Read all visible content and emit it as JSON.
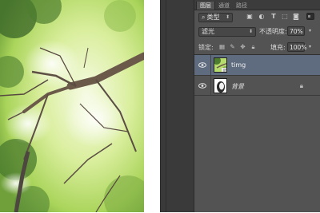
{
  "canvas": {
    "description_icon": "forest-canopy-photo"
  },
  "layers_panel": {
    "tabs": [
      {
        "label": "图层",
        "active": true
      },
      {
        "label": "通道",
        "active": false
      },
      {
        "label": "路径",
        "active": false
      }
    ],
    "filter": {
      "label": "类型",
      "icons": [
        "image-filter-icon",
        "adjustment-filter-icon",
        "type-filter-icon",
        "shape-filter-icon",
        "smart-object-filter-icon"
      ]
    },
    "blend_mode": "滤光",
    "opacity": {
      "label": "不透明度:",
      "value": "70%"
    },
    "lock": {
      "label": "锁定:",
      "icons": [
        "lock-transparent-icon",
        "lock-image-icon",
        "lock-position-icon",
        "lock-all-icon"
      ]
    },
    "fill": {
      "label": "填充:",
      "value": "100%"
    },
    "layers": [
      {
        "name": "timg",
        "selected": true,
        "visible": true,
        "locked": false
      },
      {
        "name": "背景",
        "selected": false,
        "visible": true,
        "locked": true
      }
    ]
  },
  "colors": {
    "panel_bg": "#535353",
    "selected_layer": "#5f6c80",
    "dark_bg": "#3a3a3a"
  }
}
